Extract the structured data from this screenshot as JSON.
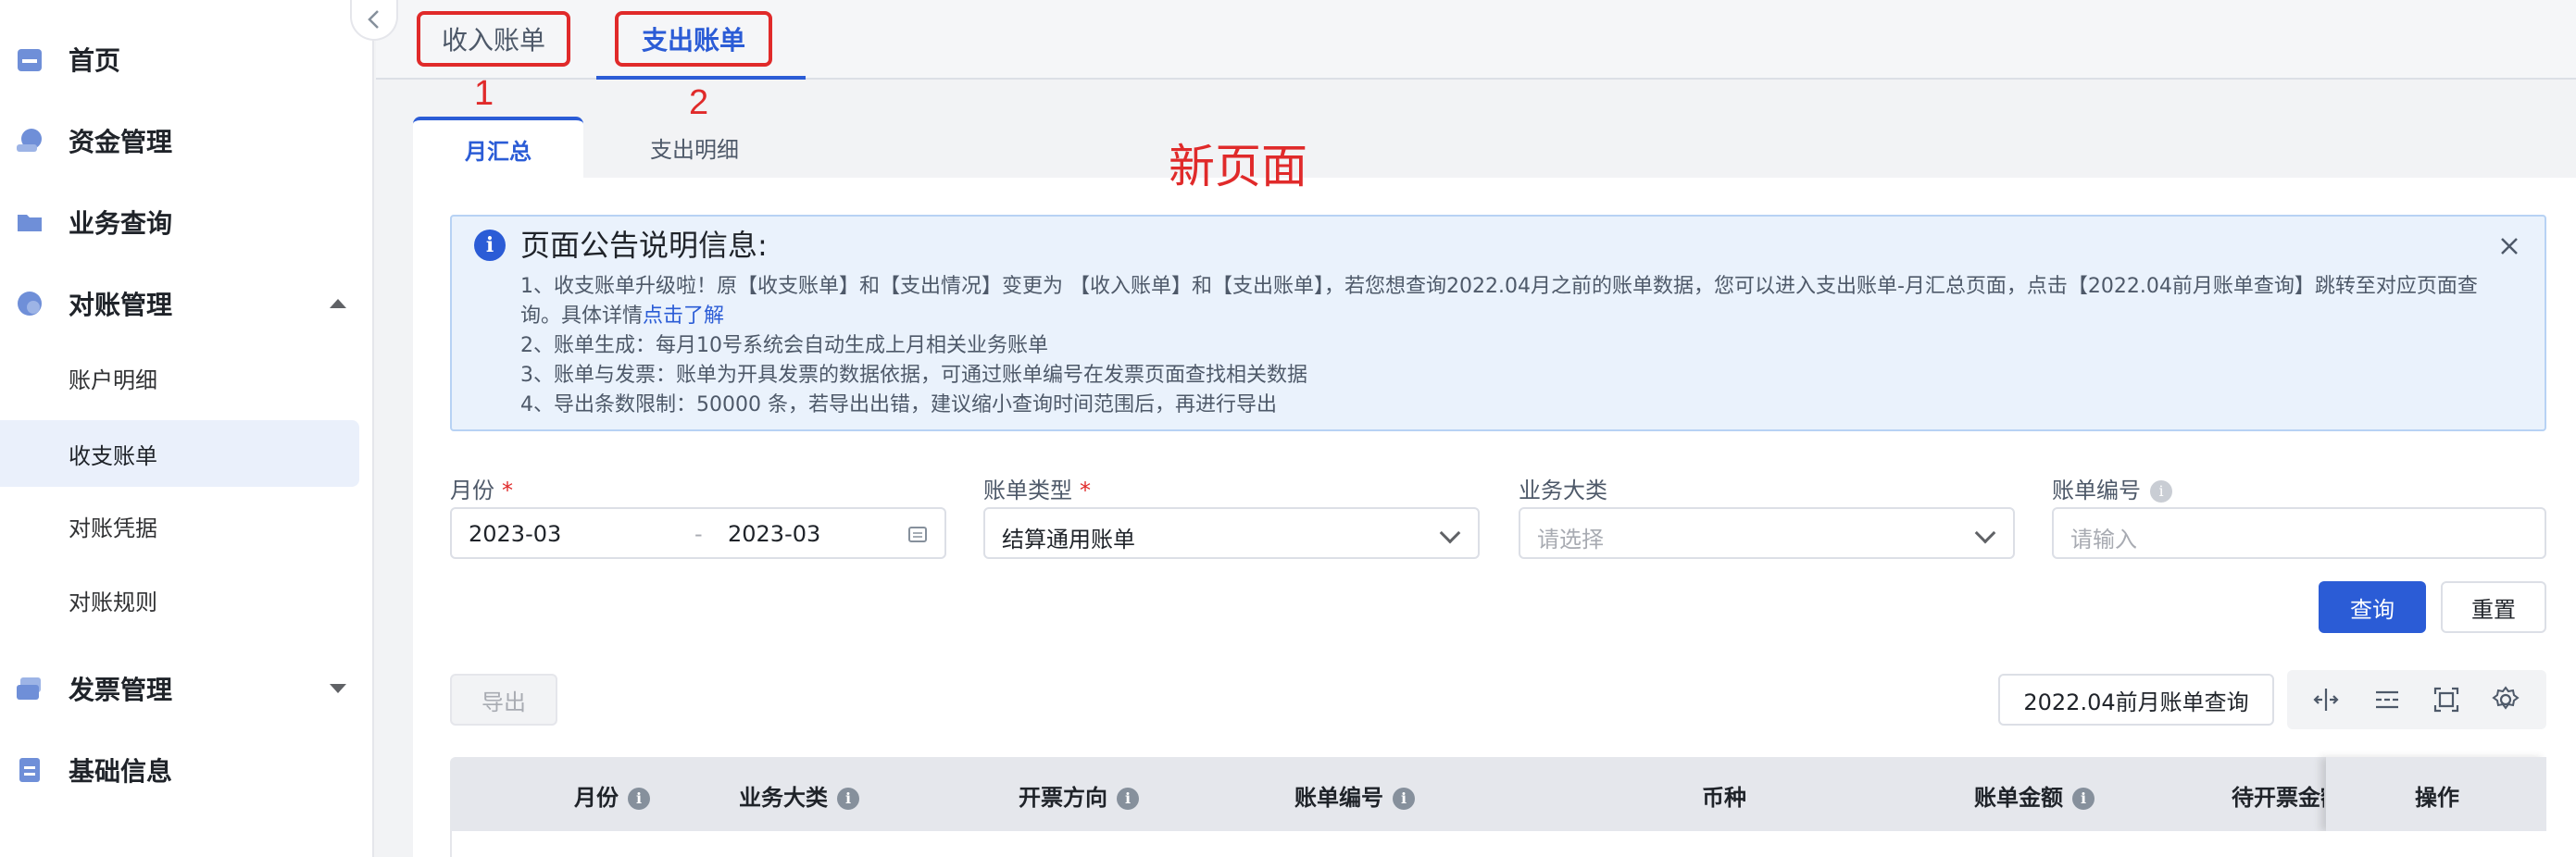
{
  "sidebar": {
    "items": [
      {
        "label": "首页",
        "icon": "home-icon"
      },
      {
        "label": "资金管理",
        "icon": "fund-icon"
      },
      {
        "label": "业务查询",
        "icon": "folder-icon"
      },
      {
        "label": "对账管理",
        "icon": "reconcile-icon"
      },
      {
        "label": "发票管理",
        "icon": "invoice-icon"
      },
      {
        "label": "基础信息",
        "icon": "document-icon"
      }
    ],
    "sub_items": [
      {
        "label": "账户明细"
      },
      {
        "label": "收支账单"
      },
      {
        "label": "对账凭据"
      },
      {
        "label": "对账规则"
      }
    ]
  },
  "top_tabs": [
    {
      "label": "收入账单"
    },
    {
      "label": "支出账单"
    }
  ],
  "annotations": {
    "one": "1",
    "two": "2",
    "new_page": "新页面"
  },
  "sub_tabs": [
    {
      "label": "月汇总"
    },
    {
      "label": "支出明细"
    }
  ],
  "notice": {
    "title": "页面公告说明信息:",
    "line1_a": "1、收支账单升级啦！原【收支账单】和【支出情况】变更为 【收入账单】和【支出账单】，若您想查询2022.04月之前的账单数据，您可以进入支出账单-月汇总页面，点击【2022.04前月账单查询】跳转至对应页面查询。具体详情",
    "line1_link": "点击了解",
    "line2": "2、账单生成：每月10号系统会自动生成上月相关业务账单",
    "line3": "3、账单与发票：账单为开具发票的数据依据，可通过账单编号在发票页面查找相关数据",
    "line4": "4、导出条数限制：50000 条，若导出出错，建议缩小查询时间范围后，再进行导出"
  },
  "filters": {
    "month_label": "月份",
    "month_start": "2023-03",
    "month_sep": "-",
    "month_end": "2023-03",
    "type_label": "账单类型",
    "type_value": "结算通用账单",
    "category_label": "业务大类",
    "category_placeholder": "请选择",
    "bill_no_label": "账单编号",
    "bill_no_placeholder": "请输入",
    "required_mark": "*"
  },
  "buttons": {
    "query": "查询",
    "reset": "重置",
    "export": "导出",
    "legacy_query": "2022.04前月账单查询"
  },
  "table": {
    "columns": [
      "月份",
      "业务大类",
      "开票方向",
      "账单编号",
      "币种",
      "账单金额",
      "待开票金额"
    ],
    "op_column": "操作",
    "info_mark": "i"
  },
  "colors": {
    "accent": "#2b5cd6",
    "annotation": "#e02a2a",
    "notice_bg": "#eaf2fc"
  }
}
